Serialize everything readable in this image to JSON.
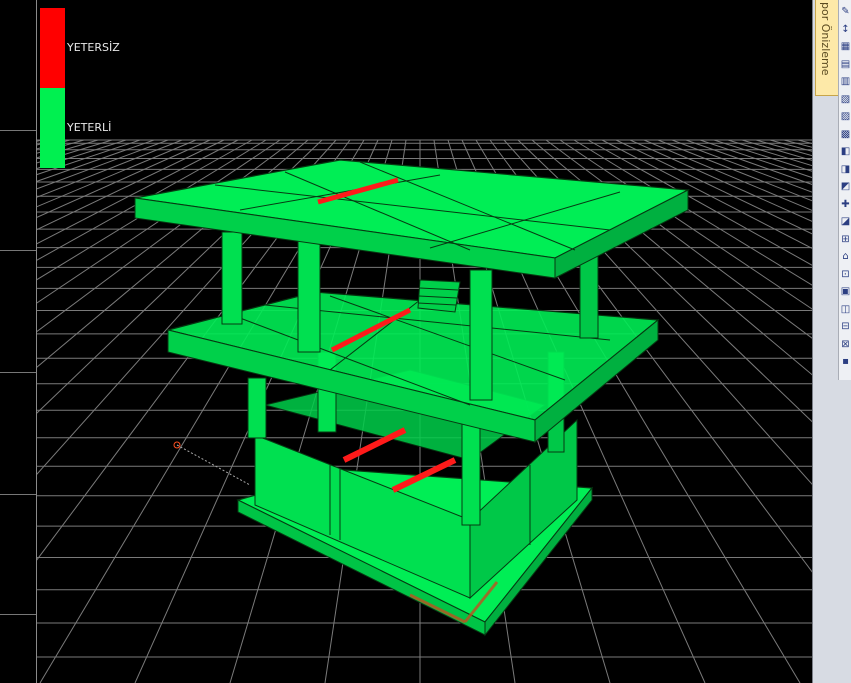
{
  "legend": {
    "insufficient": {
      "label": "YETERSİZ",
      "color": "#ff0000"
    },
    "sufficient": {
      "label": "YETERLİ",
      "color": "#00f050"
    }
  },
  "side_tab": {
    "label": "por Önizleme"
  },
  "toolbar_icons": [
    "eraser-icon",
    "beam-icon",
    "column-icon",
    "slab-icon",
    "wall-icon",
    "report-icon",
    "print-icon",
    "table-icon",
    "stair-icon",
    "foundation-icon",
    "measure-icon",
    "node-icon",
    "section-icon",
    "shear-icon",
    "axis-icon",
    "snap-icon",
    "lock-icon",
    "render-icon",
    "zoom-icon",
    "pan-icon",
    "more-icon"
  ],
  "colors": {
    "member_fill": "#00ee55",
    "member_edge": "#063a12",
    "grid": "#9a9a9a",
    "background": "#000000",
    "failed_member": "#ff1a1a"
  }
}
